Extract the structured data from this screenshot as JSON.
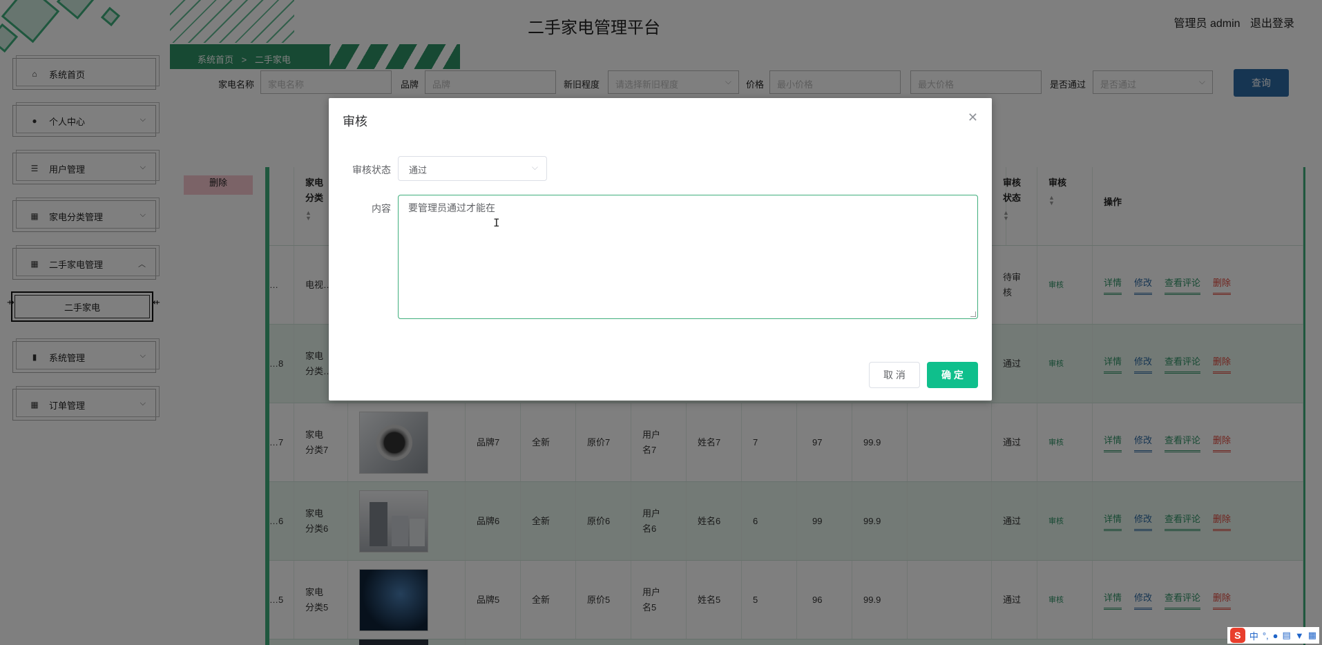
{
  "header": {
    "title": "二手家电管理平台",
    "admin_label": "管理员 admin",
    "logout": "退出登录"
  },
  "breadcrumb": {
    "home": "系统首页",
    "sep": ">",
    "current": "二手家电"
  },
  "sidebar": {
    "items": [
      {
        "label": "系统首页",
        "icon": "home-icon"
      },
      {
        "label": "个人中心",
        "icon": "person-icon"
      },
      {
        "label": "用户管理",
        "icon": "sliders-icon"
      },
      {
        "label": "家电分类管理",
        "icon": "grid-icon"
      },
      {
        "label": "二手家电管理",
        "icon": "grid-icon"
      },
      {
        "label": "系统管理",
        "icon": "bar-chart-icon"
      },
      {
        "label": "订单管理",
        "icon": "grid-icon"
      }
    ],
    "sub_item": "二手家电",
    "chevron_down": "⌵",
    "chevron_up": "︿"
  },
  "search": {
    "name_label": "家电名称",
    "name_placeholder": "家电名称",
    "brand_label": "品牌",
    "brand_placeholder": "品牌",
    "cond_label": "新旧程度",
    "cond_placeholder": "请选择新旧程度",
    "price_label": "价格",
    "min_placeholder": "最小价格",
    "max_placeholder": "最大价格",
    "pass_label": "是否通过",
    "pass_placeholder": "是否通过",
    "query_button": "查询"
  },
  "batch_delete": "删除",
  "table": {
    "headers": {
      "category": "家电\n分类",
      "audit_status": "审核\n状态",
      "audit": "审核",
      "ops": "操作"
    },
    "actions": {
      "detail": "详情",
      "edit": "修改",
      "comments": "查看评论",
      "delete": "删除"
    },
    "audit_link": "审核",
    "rows": [
      {
        "id": "…",
        "category": "电视…",
        "brand": "",
        "condition": "",
        "orig": "",
        "user": "",
        "name": "",
        "c1": "",
        "c2": "",
        "price": "",
        "status": "待审\n核"
      },
      {
        "id": "…8",
        "category": "家电\n分类…",
        "brand": "",
        "condition": "",
        "orig": "",
        "user": "",
        "name": "",
        "c1": "",
        "c2": "",
        "price": "",
        "status": "通过"
      },
      {
        "id": "…7",
        "category": "家电\n分类7",
        "brand": "品牌7",
        "condition": "全新",
        "orig": "原价7",
        "user": "用户\n名7",
        "name": "姓名7",
        "c1": "7",
        "c2": "97",
        "price": "99.9",
        "status": "通过"
      },
      {
        "id": "…6",
        "category": "家电\n分类6",
        "brand": "品牌6",
        "condition": "全新",
        "orig": "原价6",
        "user": "用户\n名6",
        "name": "姓名6",
        "c1": "6",
        "c2": "99",
        "price": "99.9",
        "status": "通过"
      },
      {
        "id": "…5",
        "category": "家电\n分类5",
        "brand": "品牌5",
        "condition": "全新",
        "orig": "原价5",
        "user": "用户\n名5",
        "name": "姓名5",
        "c1": "5",
        "c2": "96",
        "price": "99.9",
        "status": "通过"
      }
    ]
  },
  "dialog": {
    "title": "审核",
    "status_label": "审核状态",
    "status_value": "通过",
    "content_label": "内容",
    "content_value": "要管理员通过才能在",
    "cancel": "取 消",
    "confirm": "确 定"
  },
  "ime": {
    "logo": "S",
    "mode": "中"
  },
  "colors": {
    "accent": "#3fae7c",
    "primary": "#0fbf8c",
    "query": "#2d6aa4",
    "danger": "#e0463b"
  }
}
